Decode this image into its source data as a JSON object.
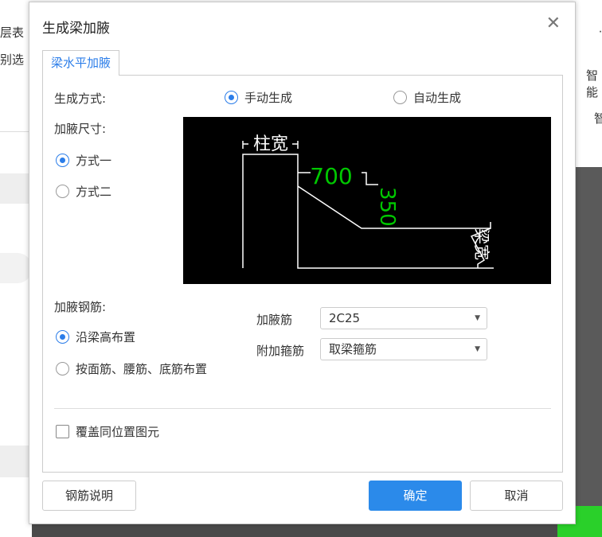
{
  "background": {
    "left_items": [
      "层表",
      "别选"
    ],
    "right_items": [
      "智能",
      "智"
    ]
  },
  "dialog": {
    "title": "生成梁加腋",
    "tab": "梁水平加腋",
    "mode_label": "生成方式:",
    "mode_options": [
      {
        "label": "手动生成",
        "checked": true
      },
      {
        "label": "自动生成",
        "checked": false
      }
    ],
    "size_label": "加腋尺寸:",
    "size_options": [
      {
        "label": "方式一",
        "checked": true
      },
      {
        "label": "方式二",
        "checked": false
      }
    ],
    "diagram": {
      "col_width": "柱宽",
      "length": "700",
      "height": "350",
      "beam_width": "梁宽"
    },
    "rebar_label": "加腋钢筋:",
    "rebar_options": [
      {
        "label": "沿梁高布置",
        "checked": true
      },
      {
        "label": "按面筋、腰筋、底筋布置",
        "checked": false
      }
    ],
    "haunch_bar_label": "加腋筋",
    "haunch_bar_value": "2C25",
    "stirrup_label": "附加箍筋",
    "stirrup_value": "取梁箍筋",
    "overwrite_label": "覆盖同位置图元",
    "overwrite_checked": false,
    "btn_help": "钢筋说明",
    "btn_ok": "确定",
    "btn_cancel": "取消"
  },
  "colors": {
    "accent": "#2b7de9",
    "primary_button": "#2b8aea",
    "dimension_text": "#00c800"
  }
}
